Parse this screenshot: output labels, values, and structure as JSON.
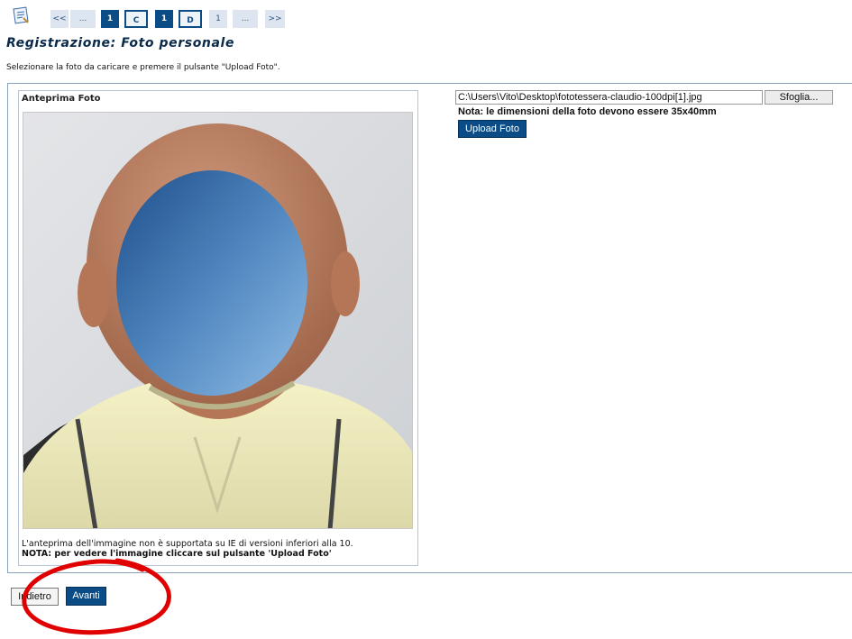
{
  "pager": {
    "first": "<<",
    "ellipsis_left": "...",
    "step_num_1": "1",
    "step_c": "C",
    "step_num_2": "1",
    "step_d": "D",
    "step_num_3": "1",
    "ellipsis_right": "...",
    "last": ">>"
  },
  "page": {
    "title": "Registrazione: Foto personale",
    "instruction": "Selezionare la foto da caricare e premere il pulsante \"Upload Foto\"."
  },
  "preview": {
    "label": "Anteprima Foto",
    "note_support": "L'anteprima dell'immagine non è supportata su IE di versioni inferiori alla 10.",
    "note_upload": "NOTA: per vedere l'immagine cliccare sul pulsante 'Upload Foto'"
  },
  "upload": {
    "file_path": "C:\\Users\\Vito\\Desktop\\fototessera-claudio-100dpi[1].jpg",
    "browse_label": "Sfoglia...",
    "dimension_note": "Nota: le dimensioni della foto devono essere 35x40mm",
    "upload_label": "Upload Foto"
  },
  "nav": {
    "back_label": "Indietro",
    "next_label": "Avanti"
  },
  "colors": {
    "primary": "#0b4c86",
    "annotation": "#e00000"
  }
}
